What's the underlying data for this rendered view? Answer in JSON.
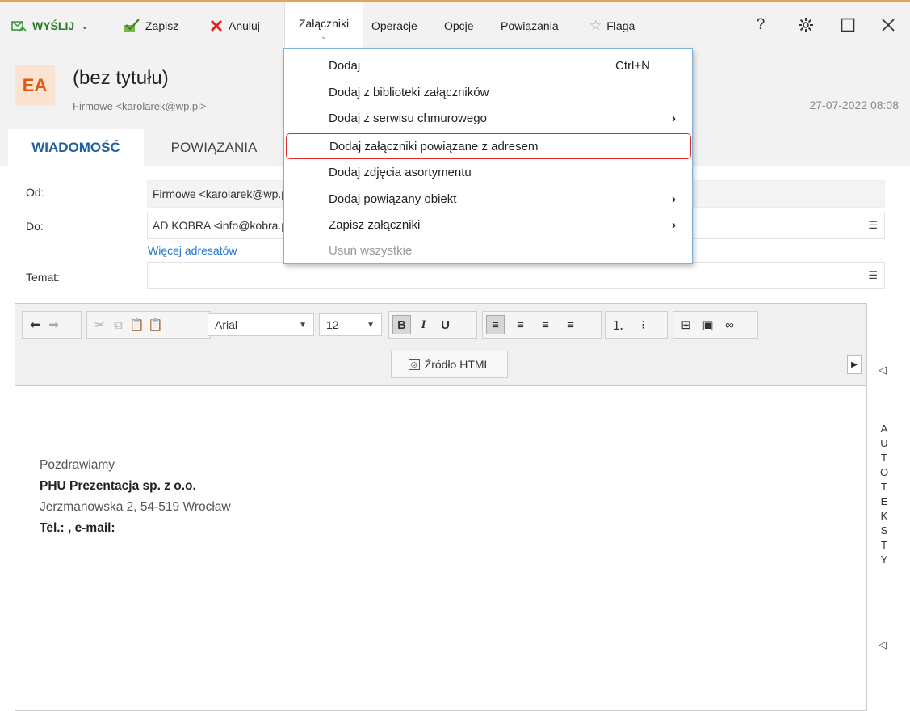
{
  "toolbar": {
    "send": "WYŚLIJ",
    "save": "Zapisz",
    "cancel": "Anuluj",
    "attachments": "Załączniki",
    "operations": "Operacje",
    "options": "Opcje",
    "relations": "Powiązania",
    "flag": "Flaga",
    "help": "?",
    "colors": {
      "send_icon": "#3a9a3a",
      "cancel_icon": "#e02020",
      "flag_icon": "#888888"
    }
  },
  "header": {
    "avatar_initials": "EA",
    "subject": "(bez tytułu)",
    "from": "Firmowe <karolarek@wp.pl>",
    "date": "27-07-2022 08:08"
  },
  "tabs": [
    {
      "label": "WIADOMOŚĆ",
      "active": true
    },
    {
      "label": "POWIĄZANIA",
      "active": false
    }
  ],
  "form": {
    "from_label": "Od:",
    "from_value": "Firmowe <karolarek@wp.pl>",
    "to_label": "Do:",
    "to_value": "AD KOBRA <info@kobra.pl>",
    "more_recipients": "Więcej adresatów",
    "subject_label": "Temat:",
    "subject_value": ""
  },
  "editor": {
    "font": "Arial",
    "size": "12",
    "html_source": "Źródło HTML",
    "signature": {
      "greeting": "Pozdrawiamy",
      "company": "PHU Prezentacja sp. z o.o.",
      "address": "Jerzmanowska 2, 54-519 Wrocław",
      "contact": "Tel.: , e-mail:"
    }
  },
  "autotext": {
    "letters": [
      "A",
      "U",
      "T",
      "O",
      "T",
      "E",
      "K",
      "S",
      "T",
      "Y"
    ]
  },
  "dropdown": {
    "items": [
      {
        "label": "Dodaj",
        "shortcut": "Ctrl+N"
      },
      {
        "label": "Dodaj z biblioteki załączników"
      },
      {
        "label": "Dodaj z serwisu chmurowego",
        "submenu": "›"
      },
      {
        "label": "Dodaj załączniki powiązane z adresem",
        "highlighted": true
      },
      {
        "label": "Dodaj zdjęcia asortymentu"
      },
      {
        "label": "Dodaj powiązany obiekt",
        "submenu": "›"
      },
      {
        "label": "Zapisz załączniki",
        "submenu": "›"
      },
      {
        "label": "Usuń wszystkie",
        "disabled": true
      }
    ]
  }
}
